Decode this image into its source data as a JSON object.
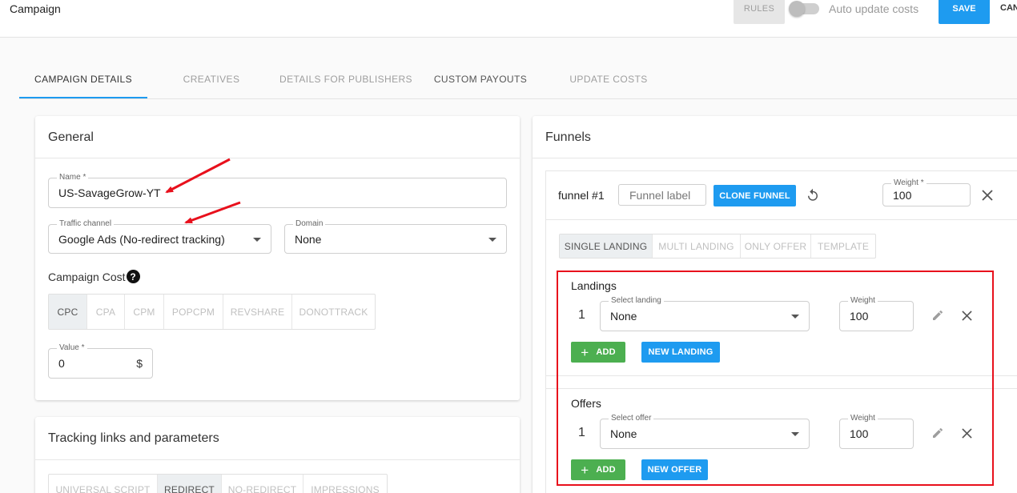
{
  "topbar": {
    "title": "Campaign",
    "rules_label": "RULES",
    "auto_update_label": "Auto update costs",
    "save_label": "SAVE",
    "cancel_label": "CANCEL"
  },
  "tabs": [
    {
      "label": "CAMPAIGN DETAILS"
    },
    {
      "label": "CREATIVES"
    },
    {
      "label": "DETAILS FOR PUBLISHERS"
    },
    {
      "label": "CUSTOM PAYOUTS"
    },
    {
      "label": "UPDATE COSTS"
    }
  ],
  "general": {
    "title": "General",
    "name_label": "Name *",
    "name_value": "US-SavageGrow-YT",
    "traffic_label": "Traffic channel",
    "traffic_value": "Google Ads (No-redirect tracking)",
    "domain_label": "Domain",
    "domain_value": "None",
    "cost_title": "Campaign Cost",
    "cost_types": [
      "CPC",
      "CPA",
      "CPM",
      "POPCPM",
      "REVSHARE",
      "DONOTTRACK"
    ],
    "value_label": "Value *",
    "value_value": "0",
    "value_suffix": "$"
  },
  "tracking": {
    "title": "Tracking links and parameters",
    "modes": [
      "UNIVERSAL SCRIPT",
      "REDIRECT",
      "NO-REDIRECT",
      "IMPRESSIONS"
    ]
  },
  "funnels": {
    "title": "Funnels",
    "funnel_name": "funnel #1",
    "funnel_label_placeholder": "Funnel label",
    "clone_label": "CLONE FUNNEL",
    "weight_label": "Weight *",
    "weight_value": "100",
    "landing_modes": [
      "SINGLE LANDING",
      "MULTI LANDING",
      "ONLY OFFER",
      "TEMPLATE"
    ],
    "landings": {
      "title": "Landings",
      "row_number": "1",
      "select_label": "Select landing",
      "select_value": "None",
      "weight_label": "Weight",
      "weight_value": "100",
      "add_label": "ADD",
      "new_label": "NEW LANDING"
    },
    "offers": {
      "title": "Offers",
      "row_number": "1",
      "select_label": "Select offer",
      "select_value": "None",
      "weight_label": "Weight",
      "weight_value": "100",
      "add_label": "ADD",
      "new_label": "NEW OFFER"
    }
  },
  "colors": {
    "accent": "#1e9bf0",
    "add_green": "#4caf50",
    "highlight_red": "#e8101c"
  }
}
